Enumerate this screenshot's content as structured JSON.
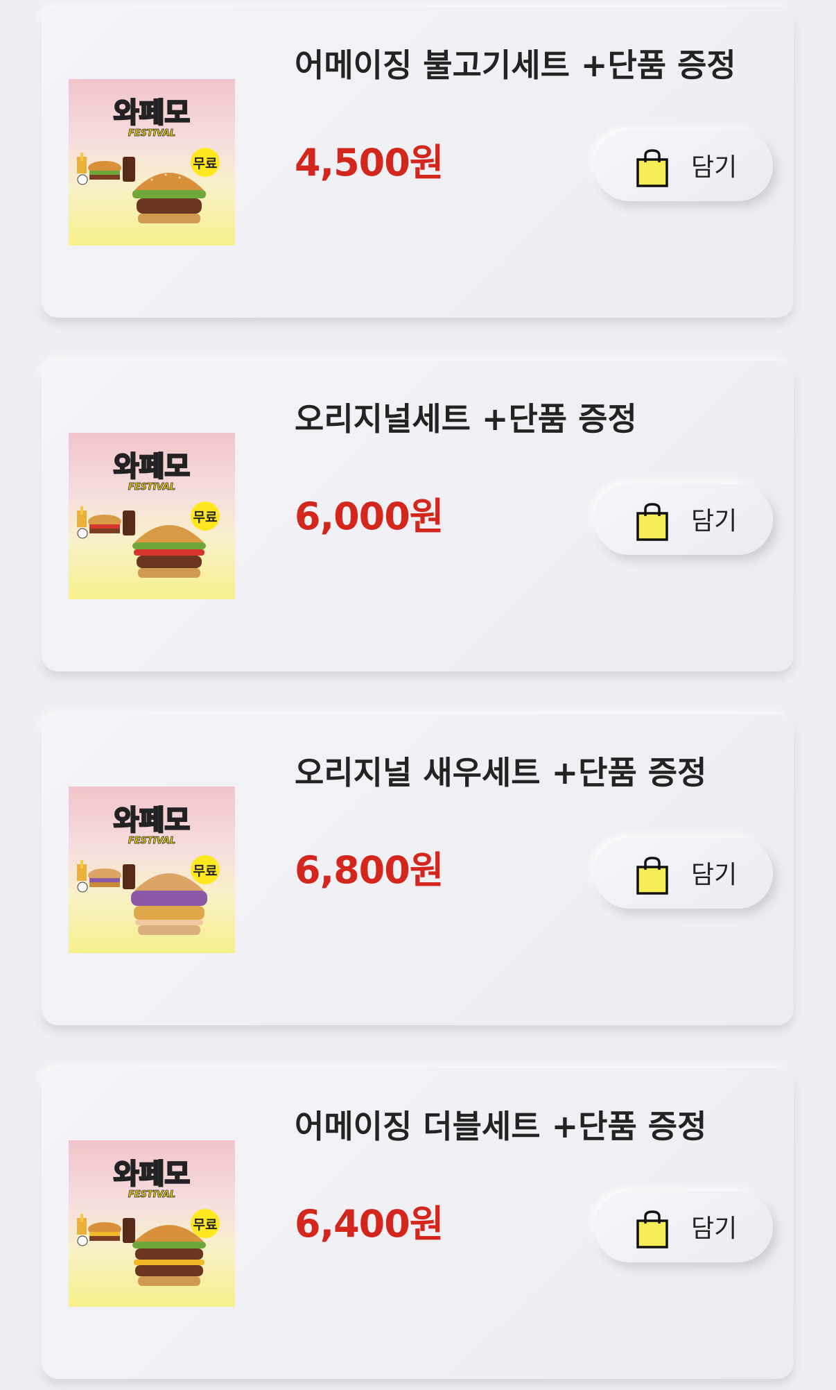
{
  "items": [
    {
      "title": "어메이징 불고기세트 +단품 증정",
      "price": "4,500원",
      "badge": "무료",
      "logo": "와페모",
      "logo_sub": "FESTIVAL",
      "add_label": "담기",
      "bun_top": "#d9903b",
      "filling": "#6fa83a"
    },
    {
      "title": "오리지널세트 +단품 증정",
      "price": "6,000원",
      "badge": "무료",
      "logo": "와페모",
      "logo_sub": "FESTIVAL",
      "add_label": "담기",
      "bun_top": "#d99a45",
      "filling": "#d7352b"
    },
    {
      "title": "오리지널 새우세트 +단품 증정",
      "price": "6,800원",
      "badge": "무료",
      "logo": "와페모",
      "logo_sub": "FESTIVAL",
      "add_label": "담기",
      "bun_top": "#dca566",
      "filling": "#8a5aa8"
    },
    {
      "title": "어메이징 더블세트 +단품 증정",
      "price": "6,400원",
      "badge": "무료",
      "logo": "와페모",
      "logo_sub": "FESTIVAL",
      "add_label": "담기",
      "bun_top": "#d9903b",
      "filling": "#f0b82a"
    }
  ],
  "colors": {
    "price": "#d3271e",
    "bag_fill": "#f7ee57",
    "badge_fill": "#ffe81f",
    "background": "#efeff3"
  },
  "icons": {
    "add_button": "shopping-bag-icon"
  }
}
